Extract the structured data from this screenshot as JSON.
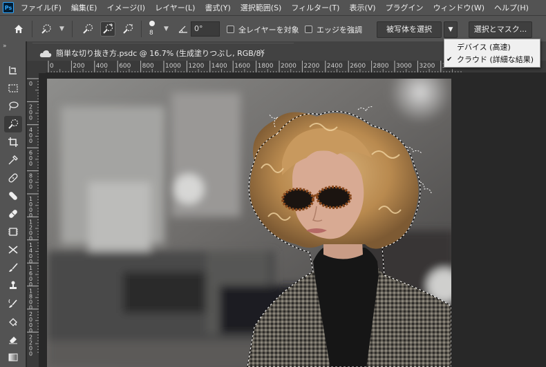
{
  "app": {
    "logo": "Ps"
  },
  "menu": [
    "ファイル(F)",
    "編集(E)",
    "イメージ(I)",
    "レイヤー(L)",
    "書式(Y)",
    "選択範囲(S)",
    "フィルター(T)",
    "表示(V)",
    "プラグイン",
    "ウィンドウ(W)",
    "ヘルプ(H)"
  ],
  "options": {
    "brush_size": "8",
    "angle": "0°",
    "sample_all_layers": "全レイヤーを対象",
    "enhance_edge": "エッジを強調",
    "select_subject": "被写体を選択",
    "select_and_mask": "選択とマスク..."
  },
  "dropdown": {
    "items": [
      {
        "label": "デバイス (高速)",
        "checked": false
      },
      {
        "label": "クラウド (詳細な結果)",
        "checked": true
      }
    ]
  },
  "document": {
    "tab_title": "簡単な切り抜き方.psdc @ 16.7% (生成塗りつぶし, RGB/8)",
    "close": "×"
  },
  "rulers": {
    "horizontal": [
      "0",
      "200",
      "400",
      "600",
      "800",
      "1000",
      "1200",
      "1400",
      "1600",
      "1800",
      "2000",
      "2200",
      "2400",
      "2600",
      "2800",
      "3000",
      "3200",
      "3400"
    ],
    "vertical": [
      "0",
      "200",
      "400",
      "600",
      "800",
      "1000",
      "1200",
      "1400",
      "1600",
      "1800",
      "2000",
      "2200"
    ]
  },
  "colors": {
    "chrome": "#535353",
    "panel": "#424242",
    "canvas_bg": "#282828",
    "accent": "#31a8ff"
  }
}
